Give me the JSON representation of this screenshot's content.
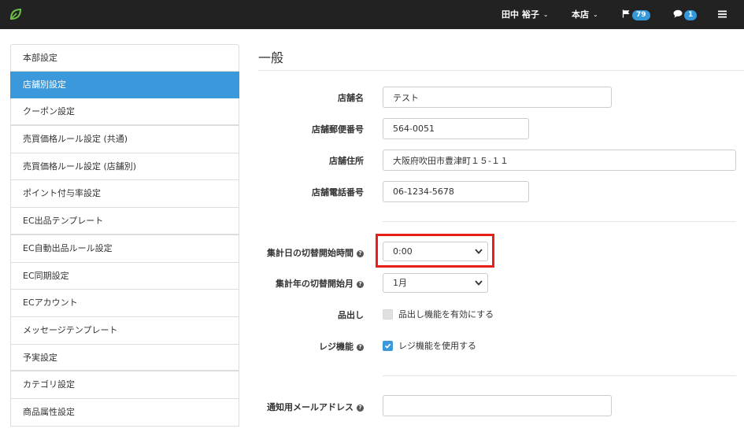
{
  "header": {
    "user_name": "田中 裕子",
    "store": "本店",
    "flag_count": "79",
    "message_count": "1",
    "colors": {
      "bar": "#222222",
      "badge": "#3498db",
      "logo": "#6cc04a"
    }
  },
  "sidebar": {
    "items": [
      {
        "label": "本部設定",
        "active": false
      },
      {
        "label": "店舗別設定",
        "active": true
      },
      {
        "label": "クーポン設定",
        "active": false
      },
      {
        "label": "売買価格ルール設定 (共通)",
        "active": false
      },
      {
        "label": "売買価格ルール設定 (店舗別)",
        "active": false
      },
      {
        "label": "ポイント付与率設定",
        "active": false
      },
      {
        "label": "EC出品テンプレート",
        "active": false
      },
      {
        "label": "EC自動出品ルール設定",
        "active": false
      },
      {
        "label": "EC同期設定",
        "active": false
      },
      {
        "label": "ECアカウント",
        "active": false
      },
      {
        "label": "メッセージテンプレート",
        "active": false
      },
      {
        "label": "予実設定",
        "active": false
      },
      {
        "label": "カテゴリ設定",
        "active": false
      },
      {
        "label": "商品属性設定",
        "active": false
      }
    ],
    "active_color": "#3a98db"
  },
  "main": {
    "title": "一般",
    "fields": {
      "store_name": {
        "label": "店舗名",
        "value": "テスト"
      },
      "postal_code": {
        "label": "店舗郵便番号",
        "value": "564-0051"
      },
      "address": {
        "label": "店舗住所",
        "value": "大阪府吹田市豊津町１５-１１"
      },
      "phone": {
        "label": "店舗電話番号",
        "value": "06-1234-5678"
      },
      "day_switch": {
        "label": "集計日の切替開始時間",
        "value": "0:00"
      },
      "year_switch": {
        "label": "集計年の切替開始月",
        "value": "1月"
      },
      "picking": {
        "label": "品出し",
        "checkbox_label": "品出し機能を有効にする",
        "checked": false
      },
      "register": {
        "label": "レジ機能",
        "checkbox_label": "レジ機能を使用する",
        "checked": true
      },
      "notify_email": {
        "label": "通知用メールアドレス",
        "value": ""
      }
    },
    "highlight_color": "#e8201d"
  }
}
